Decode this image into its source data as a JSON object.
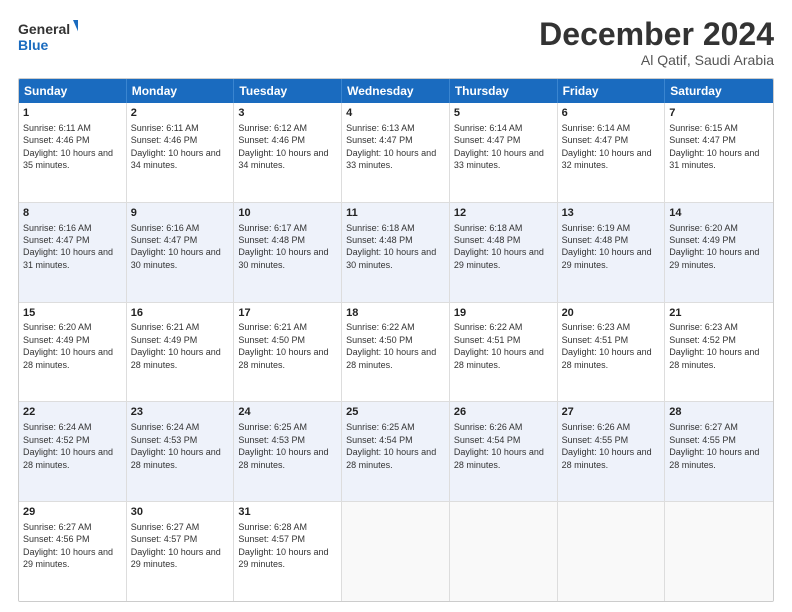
{
  "logo": {
    "line1": "General",
    "line2": "Blue"
  },
  "title": "December 2024",
  "location": "Al Qatif, Saudi Arabia",
  "days_of_week": [
    "Sunday",
    "Monday",
    "Tuesday",
    "Wednesday",
    "Thursday",
    "Friday",
    "Saturday"
  ],
  "rows": [
    [
      {
        "day": "1",
        "sunrise": "6:11 AM",
        "sunset": "4:46 PM",
        "daylight": "10 hours and 35 minutes."
      },
      {
        "day": "2",
        "sunrise": "6:11 AM",
        "sunset": "4:46 PM",
        "daylight": "10 hours and 34 minutes."
      },
      {
        "day": "3",
        "sunrise": "6:12 AM",
        "sunset": "4:46 PM",
        "daylight": "10 hours and 34 minutes."
      },
      {
        "day": "4",
        "sunrise": "6:13 AM",
        "sunset": "4:47 PM",
        "daylight": "10 hours and 33 minutes."
      },
      {
        "day": "5",
        "sunrise": "6:14 AM",
        "sunset": "4:47 PM",
        "daylight": "10 hours and 33 minutes."
      },
      {
        "day": "6",
        "sunrise": "6:14 AM",
        "sunset": "4:47 PM",
        "daylight": "10 hours and 32 minutes."
      },
      {
        "day": "7",
        "sunrise": "6:15 AM",
        "sunset": "4:47 PM",
        "daylight": "10 hours and 31 minutes."
      }
    ],
    [
      {
        "day": "8",
        "sunrise": "6:16 AM",
        "sunset": "4:47 PM",
        "daylight": "10 hours and 31 minutes."
      },
      {
        "day": "9",
        "sunrise": "6:16 AM",
        "sunset": "4:47 PM",
        "daylight": "10 hours and 30 minutes."
      },
      {
        "day": "10",
        "sunrise": "6:17 AM",
        "sunset": "4:48 PM",
        "daylight": "10 hours and 30 minutes."
      },
      {
        "day": "11",
        "sunrise": "6:18 AM",
        "sunset": "4:48 PM",
        "daylight": "10 hours and 30 minutes."
      },
      {
        "day": "12",
        "sunrise": "6:18 AM",
        "sunset": "4:48 PM",
        "daylight": "10 hours and 29 minutes."
      },
      {
        "day": "13",
        "sunrise": "6:19 AM",
        "sunset": "4:48 PM",
        "daylight": "10 hours and 29 minutes."
      },
      {
        "day": "14",
        "sunrise": "6:20 AM",
        "sunset": "4:49 PM",
        "daylight": "10 hours and 29 minutes."
      }
    ],
    [
      {
        "day": "15",
        "sunrise": "6:20 AM",
        "sunset": "4:49 PM",
        "daylight": "10 hours and 28 minutes."
      },
      {
        "day": "16",
        "sunrise": "6:21 AM",
        "sunset": "4:49 PM",
        "daylight": "10 hours and 28 minutes."
      },
      {
        "day": "17",
        "sunrise": "6:21 AM",
        "sunset": "4:50 PM",
        "daylight": "10 hours and 28 minutes."
      },
      {
        "day": "18",
        "sunrise": "6:22 AM",
        "sunset": "4:50 PM",
        "daylight": "10 hours and 28 minutes."
      },
      {
        "day": "19",
        "sunrise": "6:22 AM",
        "sunset": "4:51 PM",
        "daylight": "10 hours and 28 minutes."
      },
      {
        "day": "20",
        "sunrise": "6:23 AM",
        "sunset": "4:51 PM",
        "daylight": "10 hours and 28 minutes."
      },
      {
        "day": "21",
        "sunrise": "6:23 AM",
        "sunset": "4:52 PM",
        "daylight": "10 hours and 28 minutes."
      }
    ],
    [
      {
        "day": "22",
        "sunrise": "6:24 AM",
        "sunset": "4:52 PM",
        "daylight": "10 hours and 28 minutes."
      },
      {
        "day": "23",
        "sunrise": "6:24 AM",
        "sunset": "4:53 PM",
        "daylight": "10 hours and 28 minutes."
      },
      {
        "day": "24",
        "sunrise": "6:25 AM",
        "sunset": "4:53 PM",
        "daylight": "10 hours and 28 minutes."
      },
      {
        "day": "25",
        "sunrise": "6:25 AM",
        "sunset": "4:54 PM",
        "daylight": "10 hours and 28 minutes."
      },
      {
        "day": "26",
        "sunrise": "6:26 AM",
        "sunset": "4:54 PM",
        "daylight": "10 hours and 28 minutes."
      },
      {
        "day": "27",
        "sunrise": "6:26 AM",
        "sunset": "4:55 PM",
        "daylight": "10 hours and 28 minutes."
      },
      {
        "day": "28",
        "sunrise": "6:27 AM",
        "sunset": "4:55 PM",
        "daylight": "10 hours and 28 minutes."
      }
    ],
    [
      {
        "day": "29",
        "sunrise": "6:27 AM",
        "sunset": "4:56 PM",
        "daylight": "10 hours and 29 minutes."
      },
      {
        "day": "30",
        "sunrise": "6:27 AM",
        "sunset": "4:57 PM",
        "daylight": "10 hours and 29 minutes."
      },
      {
        "day": "31",
        "sunrise": "6:28 AM",
        "sunset": "4:57 PM",
        "daylight": "10 hours and 29 minutes."
      },
      null,
      null,
      null,
      null
    ]
  ],
  "colors": {
    "header_bg": "#1a6bbf",
    "alt_row_bg": "#eef2fa",
    "cell_bg": "#ffffff",
    "empty_bg": "#f9f9f9"
  }
}
